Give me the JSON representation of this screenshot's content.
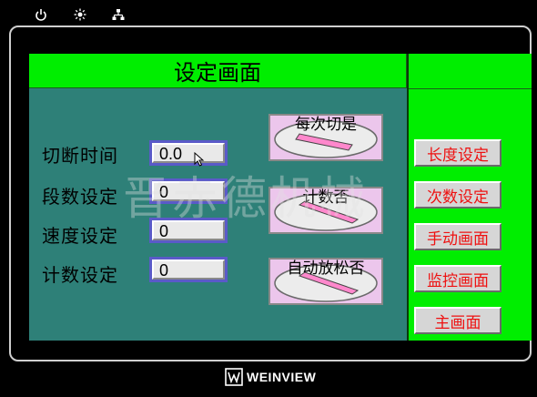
{
  "header": {
    "title": "设定画面"
  },
  "fields": [
    {
      "label": "切断时间",
      "value": "0.0"
    },
    {
      "label": "段数设定",
      "value": "0"
    },
    {
      "label": "速度设定",
      "value": "0"
    },
    {
      "label": "计数设定",
      "value": "0"
    }
  ],
  "toggles": [
    {
      "label": "每次切是"
    },
    {
      "label": "计数否"
    },
    {
      "label": "自动放松否"
    }
  ],
  "nav_buttons": [
    "长度设定",
    "次数设定",
    "手动画面",
    "监控画面",
    "主画面"
  ],
  "watermark": "晋赤德机械",
  "brand": {
    "text": "WEINVIEW"
  },
  "status_icons": [
    "power-icon",
    "brightness-icon",
    "network-icon"
  ],
  "colors": {
    "panel_green": "#00ee00",
    "screen_teal": "#2e8078",
    "nav_text_red": "#ee1111",
    "toggle_pink": "#ecc6ec"
  }
}
